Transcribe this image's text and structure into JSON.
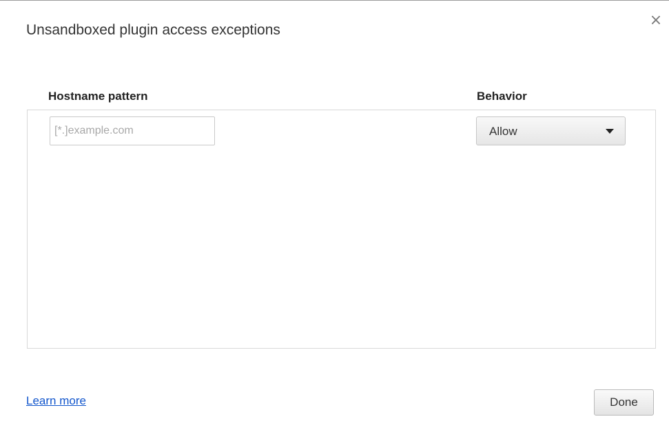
{
  "dialog": {
    "title": "Unsandboxed plugin access exceptions",
    "close_glyph": "×",
    "close_icon": "close-icon"
  },
  "columns": {
    "hostname": "Hostname pattern",
    "behavior": "Behavior"
  },
  "row": {
    "hostname_value": "",
    "hostname_placeholder": "[*.]example.com",
    "behavior_selected": "Allow",
    "behavior_icon": "chevron-down-icon"
  },
  "footer": {
    "learn_more": "Learn more",
    "done": "Done"
  },
  "colors": {
    "link": "#1155cc",
    "title": "#333333"
  }
}
